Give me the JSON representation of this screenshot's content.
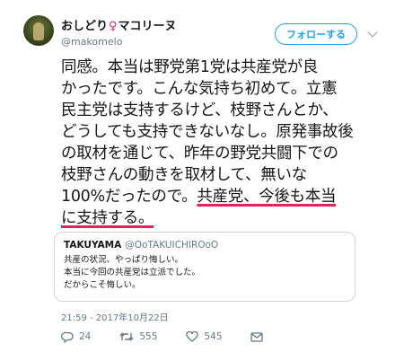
{
  "user": {
    "display_name_prefix": "おしどり",
    "gender_symbol": "♀",
    "display_name_suffix": "マコリーヌ",
    "handle": "@makomelo"
  },
  "follow_label": "フォローする",
  "tweet": {
    "lines": [
      "同感。本当は野党第1党は共産党が良",
      "かったです。こんな気持ち初めて。立憲",
      "民主党は支持するけど、枝野さんとか、",
      "どうしても支持できないなし。原発事故後",
      "の取材を通じて、昨年の野党共闘下での",
      "枝野さんの動きを取材して、無いな"
    ],
    "line7_plain": "100%だったので。",
    "line7_highlight": "共産党、今後も本当",
    "line8_highlight": "に支持する。"
  },
  "quote": {
    "name": "TAKUYAMA",
    "handle": "@OoTAKUICHIROoO",
    "lines": [
      "共産の状況、やっぱり悔しい。",
      "本当に今回の共産党は立派でした。",
      "だからこそ悔しい。"
    ]
  },
  "timestamp": "21:59 - 2017年10月22日",
  "actions": {
    "replies": "24",
    "retweets": "555",
    "likes": "545"
  },
  "colors": {
    "accent": "#1da1f2",
    "highlight_underline": "#e0245e",
    "secondary_text": "#657786"
  }
}
